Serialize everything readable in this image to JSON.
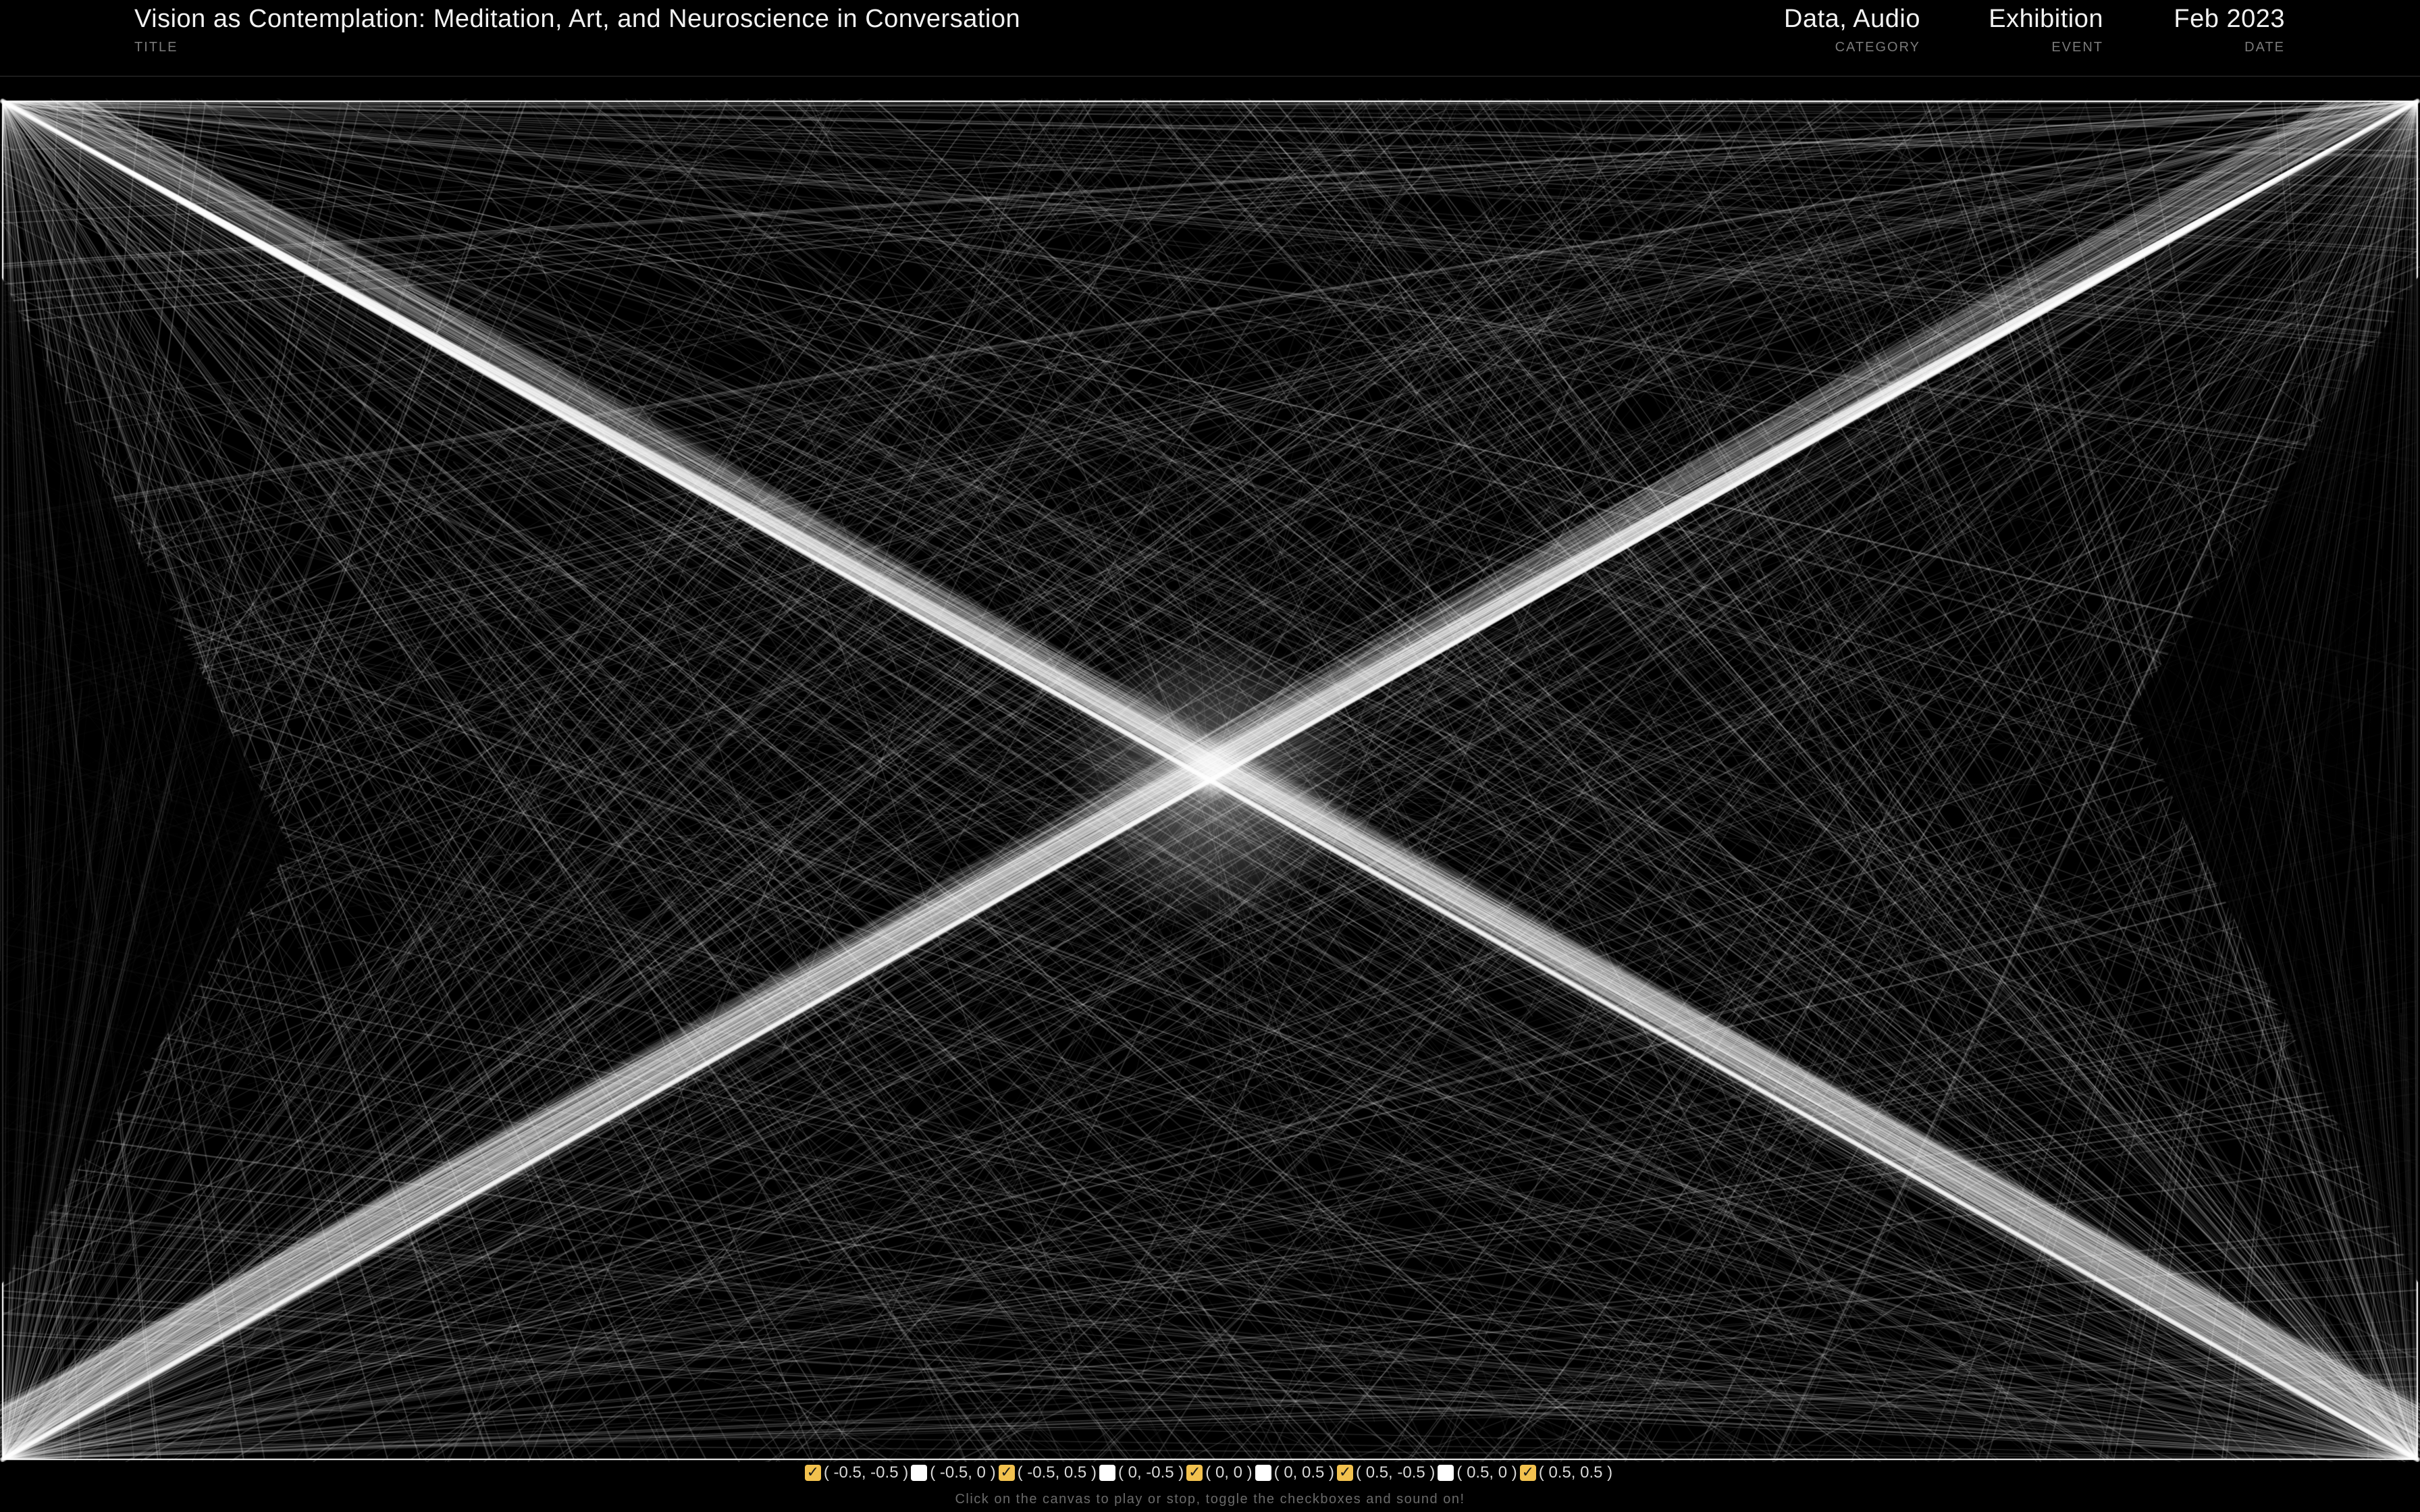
{
  "header": {
    "title": {
      "value": "Vision as Contemplation: Meditation, Art, and Neuroscience in Conversation",
      "label": "TITLE"
    },
    "category": {
      "value": "Data, Audio",
      "label": "CATEGORY"
    },
    "event": {
      "value": "Exhibition",
      "label": "EVENT"
    },
    "date": {
      "value": "Feb 2023",
      "label": "DATE"
    }
  },
  "controls": {
    "checkboxes": [
      {
        "label": "( -0.5, -0.5 )",
        "checked": true
      },
      {
        "label": "( -0.5, 0 )",
        "checked": false
      },
      {
        "label": "( -0.5, 0.5 )",
        "checked": true
      },
      {
        "label": "( 0, -0.5 )",
        "checked": false
      },
      {
        "label": "( 0, 0 )",
        "checked": true
      },
      {
        "label": "( 0, 0.5 )",
        "checked": false
      },
      {
        "label": "( 0.5, -0.5 )",
        "checked": true
      },
      {
        "label": "( 0.5, 0 )",
        "checked": false
      },
      {
        "label": "( 0.5, 0.5 )",
        "checked": true
      }
    ],
    "checked_color": "#f2c14e",
    "hint": "Click on the canvas to play or stop, toggle the checkboxes and sound on!"
  },
  "canvas": {
    "background": "#000000",
    "line_color": "#ffffff"
  }
}
